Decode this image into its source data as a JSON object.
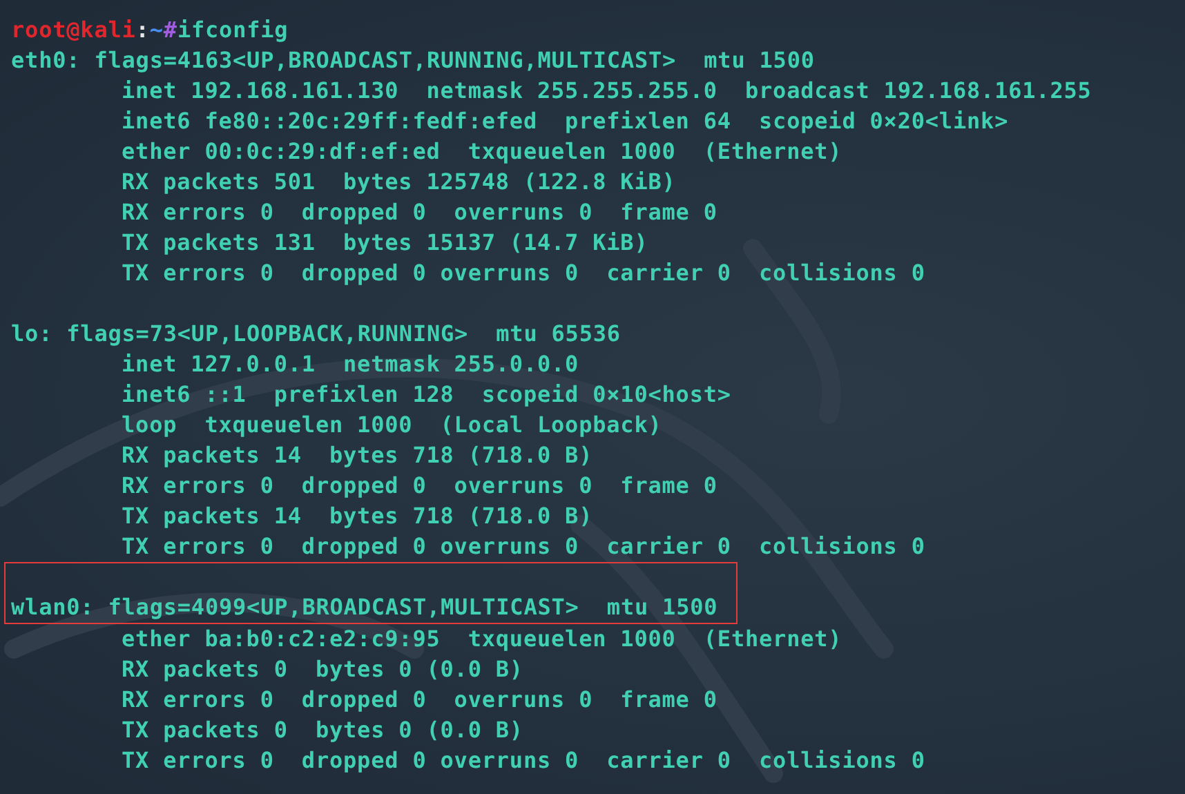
{
  "prompt": {
    "user": "root@kali",
    "separator": ":",
    "path": "~",
    "symbol": "#",
    "command": "ifconfig"
  },
  "interfaces": [
    {
      "header": "eth0: flags=4163<UP,BROADCAST,RUNNING,MULTICAST>  mtu 1500",
      "highlighted": false,
      "lines": [
        "inet 192.168.161.130  netmask 255.255.255.0  broadcast 192.168.161.255",
        "inet6 fe80::20c:29ff:fedf:efed  prefixlen 64  scopeid 0×20<link>",
        "ether 00:0c:29:df:ef:ed  txqueuelen 1000  (Ethernet)",
        "RX packets 501  bytes 125748 (122.8 KiB)",
        "RX errors 0  dropped 0  overruns 0  frame 0",
        "TX packets 131  bytes 15137 (14.7 KiB)",
        "TX errors 0  dropped 0 overruns 0  carrier 0  collisions 0"
      ]
    },
    {
      "header": "lo: flags=73<UP,LOOPBACK,RUNNING>  mtu 65536",
      "highlighted": false,
      "lines": [
        "inet 127.0.0.1  netmask 255.0.0.0",
        "inet6 ::1  prefixlen 128  scopeid 0×10<host>",
        "loop  txqueuelen 1000  (Local Loopback)",
        "RX packets 14  bytes 718 (718.0 B)",
        "RX errors 0  dropped 0  overruns 0  frame 0",
        "TX packets 14  bytes 718 (718.0 B)",
        "TX errors 0  dropped 0 overruns 0  carrier 0  collisions 0"
      ]
    },
    {
      "header": "wlan0: flags=4099<UP,BROADCAST,MULTICAST>  mtu 1500",
      "highlighted": true,
      "lines": [
        "ether ba:b0:c2:e2:c9:95  txqueuelen 1000  (Ethernet)",
        "RX packets 0  bytes 0 (0.0 B)",
        "RX errors 0  dropped 0  overruns 0  frame 0",
        "TX packets 0  bytes 0 (0.0 B)",
        "TX errors 0  dropped 0 overruns 0  carrier 0  collisions 0"
      ]
    }
  ]
}
